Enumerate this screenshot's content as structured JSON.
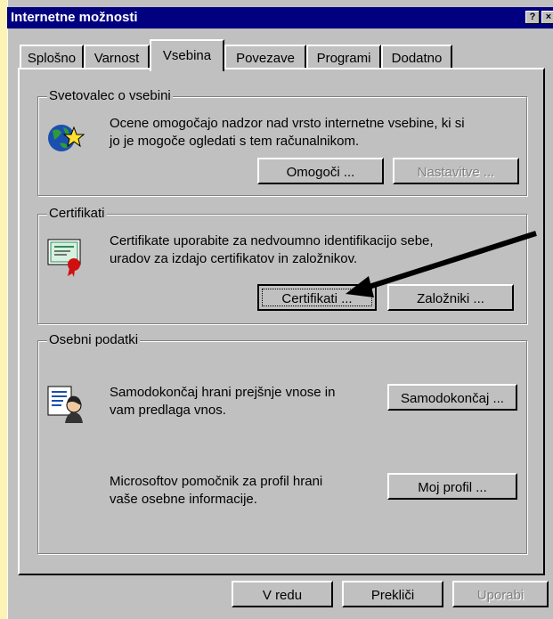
{
  "window": {
    "title": "Internetne možnosti",
    "help_glyph": "?",
    "close_glyph": "×"
  },
  "tabs": [
    {
      "label": "Splošno"
    },
    {
      "label": "Varnost"
    },
    {
      "label": "Vsebina"
    },
    {
      "label": "Povezave"
    },
    {
      "label": "Programi"
    },
    {
      "label": "Dodatno"
    }
  ],
  "content_advisor": {
    "legend": "Svetovalec o vsebini",
    "text1": "Ocene omogočajo nadzor nad vrsto internetne vsebine, ki si",
    "text2": "jo je mogoče ogledati s tem računalnikom.",
    "enable_btn": "Omogoči ...",
    "settings_btn": "Nastavitve ..."
  },
  "certificates": {
    "legend": "Certifikati",
    "text1": "Certifikate uporabite za nedvoumno identifikacijo sebe,",
    "text2": "uradov za izdajo certifikatov in založnikov.",
    "cert_btn": "Certifikati ...",
    "publishers_btn": "Založniki ..."
  },
  "personal": {
    "legend": "Osebni podatki",
    "auto_text1": "Samodokončaj hrani prejšnje vnose in",
    "auto_text2": "vam predlaga vnos.",
    "auto_btn": "Samodokončaj ...",
    "profile_text1": "Microsoftov pomočnik za profil hrani",
    "profile_text2": "vaše osebne informacije.",
    "profile_btn": "Moj profil ..."
  },
  "footer": {
    "ok": "V redu",
    "cancel": "Prekliči",
    "apply": "Uporabi"
  },
  "colors": {
    "face": "#c0c0c0",
    "title": "#000080",
    "background": "#fdf3b4"
  }
}
